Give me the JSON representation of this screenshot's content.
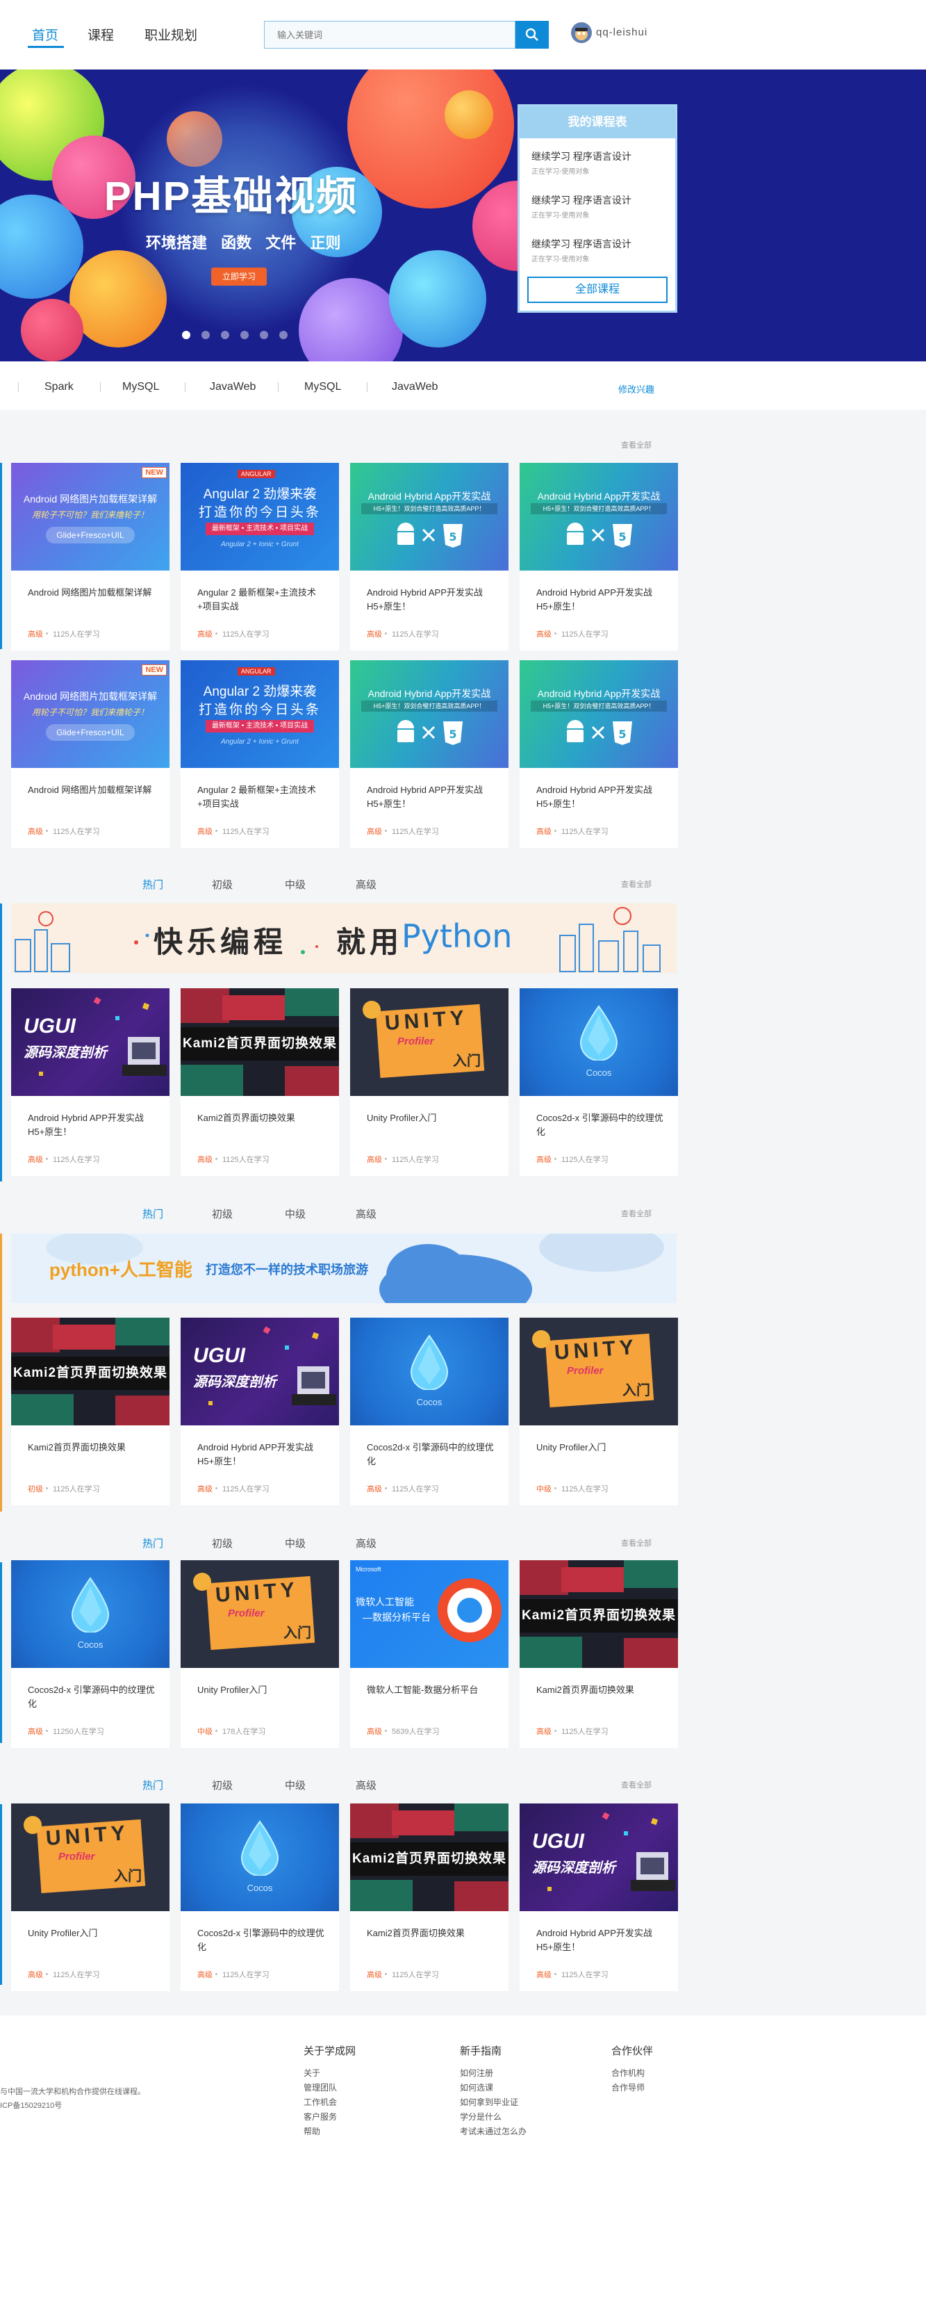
{
  "header": {
    "nav": [
      "首页",
      "课程",
      "职业规划"
    ],
    "search_placeholder": "输入关键词",
    "username": "qq-leishui"
  },
  "banner": {
    "title": "PHP基础视频",
    "subtitle": "环境搭建 函数 文件 正则",
    "button": "立即学习",
    "my_courses": {
      "title": "我的课程表",
      "items": [
        {
          "action": "继续学习",
          "course": "程序语言设计",
          "meta": "正在学习-使用对象"
        },
        {
          "action": "继续学习",
          "course": "程序语言设计",
          "meta": "正在学习-使用对象"
        },
        {
          "action": "继续学习",
          "course": "程序语言设计",
          "meta": "正在学习-使用对象"
        }
      ],
      "all_button": "全部课程"
    }
  },
  "interests": {
    "tags": [
      "Spark",
      "MySQL",
      "JavaWeb",
      "MySQL",
      "JavaWeb"
    ],
    "edit": "修改兴趣"
  },
  "view_all": "查看全部",
  "level_tabs": [
    "热门",
    "初级",
    "中级",
    "高级"
  ],
  "section1": {
    "row1": [
      {
        "theme": "android",
        "title": "Android 网络图片加载框架详解",
        "level": "高级",
        "count": "1125人在学习"
      },
      {
        "theme": "angular",
        "title": "Angular 2 最新框架+主流技术+项目实战",
        "level": "高级",
        "count": "1125人在学习"
      },
      {
        "theme": "hybrid",
        "title": "Android Hybrid APP开发实战 H5+原生！",
        "level": "高级",
        "count": "1125人在学习"
      },
      {
        "theme": "hybrid",
        "title": "Android Hybrid APP开发实战 H5+原生！",
        "level": "高级",
        "count": "1125人在学习"
      }
    ],
    "row2": [
      {
        "theme": "android",
        "title": "Android 网络图片加载框架详解",
        "level": "高级",
        "count": "1125人在学习"
      },
      {
        "theme": "angular",
        "title": "Angular 2 最新框架+主流技术+项目实战",
        "level": "高级",
        "count": "1125人在学习"
      },
      {
        "theme": "hybrid",
        "title": "Android Hybrid APP开发实战 H5+原生！",
        "level": "高级",
        "count": "1125人在学习"
      },
      {
        "theme": "hybrid",
        "title": "Android Hybrid APP开发实战 H5+原生！",
        "level": "高级",
        "count": "1125人在学习"
      }
    ]
  },
  "section2": {
    "promo_left": "快乐编程",
    "promo_mid": "就用",
    "promo_right": "Python",
    "cards": [
      {
        "theme": "ugui",
        "title": "Android Hybrid APP开发实战 H5+原生！",
        "level": "高级",
        "count": "1125人在学习"
      },
      {
        "theme": "kami",
        "title": "Kami2首页界面切换效果",
        "level": "高级",
        "count": "1125人在学习"
      },
      {
        "theme": "unity",
        "title": "Unity Profiler入门",
        "level": "高级",
        "count": "1125人在学习"
      },
      {
        "theme": "cocos",
        "title": "Cocos2d-x 引擎源码中的纹理优化",
        "level": "高级",
        "count": "1125人在学习"
      }
    ]
  },
  "section3": {
    "promo_left": "python+人工智能",
    "promo_right": "打造您不一样的技术职场旅游",
    "cards": [
      {
        "theme": "kami",
        "title": "Kami2首页界面切换效果",
        "level": "初级",
        "count": "1125人在学习"
      },
      {
        "theme": "ugui",
        "title": "Android Hybrid APP开发实战 H5+原生！",
        "level": "高级",
        "count": "1125人在学习"
      },
      {
        "theme": "cocos",
        "title": "Cocos2d-x 引擎源码中的纹理优化",
        "level": "高级",
        "count": "1125人在学习"
      },
      {
        "theme": "unity",
        "title": "Unity Profiler入门",
        "level": "中级",
        "count": "1125人在学习"
      }
    ]
  },
  "section4": {
    "cards": [
      {
        "theme": "cocos",
        "title": "Cocos2d-x 引擎源码中的纹理优化",
        "level": "高级",
        "count": "11250人在学习"
      },
      {
        "theme": "unity",
        "title": "Unity Profiler入门",
        "level": "中级",
        "count": "178人在学习"
      },
      {
        "theme": "ms",
        "title": "微软人工智能-数据分析平台",
        "level": "高级",
        "count": "5639人在学习"
      },
      {
        "theme": "kami",
        "title": "Kami2首页界面切换效果",
        "level": "高级",
        "count": "1125人在学习"
      }
    ]
  },
  "section5": {
    "cards": [
      {
        "theme": "unity",
        "title": "Unity Profiler入门",
        "level": "高级",
        "count": "1125人在学习"
      },
      {
        "theme": "cocos",
        "title": "Cocos2d-x 引擎源码中的纹理优化",
        "level": "高级",
        "count": "1125人在学习"
      },
      {
        "theme": "kami",
        "title": "Kami2首页界面切换效果",
        "level": "高级",
        "count": "1125人在学习"
      },
      {
        "theme": "ugui",
        "title": "Android Hybrid APP开发实战 H5+原生！",
        "level": "高级",
        "count": "1125人在学习"
      }
    ]
  },
  "thumb_text": {
    "android_l1": "Android 网络图片加载框架详解",
    "android_l2": "用轮子不可怕？我们来撸轮子！",
    "android_l3": "Glide+Fresco+UIL",
    "new_badge": "NEW",
    "angular_logo": "ANGULAR",
    "angular_l1": "Angular 2 劲爆来袭",
    "angular_l2": "打造你的今日头条",
    "angular_l3": "最新框架 • 主流技术 • 项目实战",
    "angular_l4": "Angular 2 + Ionic + Grunt",
    "hybrid_l1": "Android Hybrid App开发实战",
    "hybrid_l2": "H5+原生！双剑合璧打造高效高质APP！",
    "ugui_l1": "UGUI",
    "ugui_l2": "源码深度剖析",
    "kami": "Kami2首页界面切换效果",
    "unity_l1": "UNITY",
    "unity_l2": "Profiler",
    "unity_l3": "入门",
    "cocos": "Cocos",
    "ms_brand": "Microsoft",
    "ms_l1": "微软人工智能",
    "ms_l2": "—数据分析平台"
  },
  "footer": {
    "info": [
      "与中国一流大学和机构合作提供在线课程。",
      "ICP备15029210号"
    ],
    "columns": [
      {
        "title": "关于学成网",
        "items": [
          "关于",
          "管理团队",
          "工作机会",
          "客户服务",
          "帮助"
        ]
      },
      {
        "title": "新手指南",
        "items": [
          "如何注册",
          "如何选课",
          "如何拿到毕业证",
          "学分是什么",
          "考试未通过怎么办"
        ]
      },
      {
        "title": "合作伙伴",
        "items": [
          "合作机构",
          "合作导师"
        ]
      }
    ]
  },
  "colors": {
    "accent": "#0e8ad6",
    "level": "#f0622a",
    "banner_bg": "#1a1f8e"
  }
}
